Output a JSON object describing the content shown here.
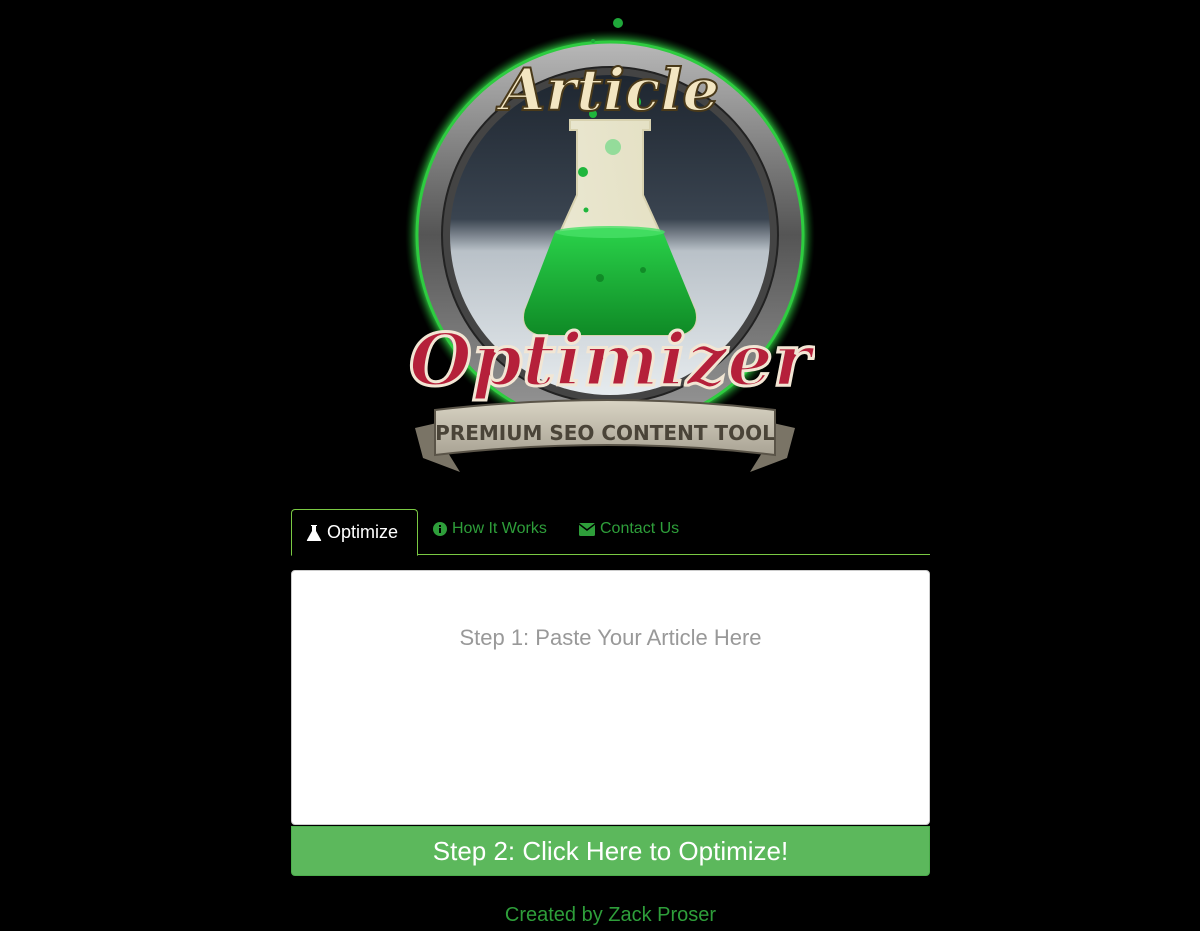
{
  "logo": {
    "word_top": "Article",
    "word_main": "Optimizer",
    "ribbon": "PREMIUM SEO CONTENT TOOL",
    "icon": "flask-logo"
  },
  "tabs": [
    {
      "label": "Optimize",
      "icon": "flask-icon",
      "active": true
    },
    {
      "label": "How It Works",
      "icon": "info-circle-icon",
      "active": false
    },
    {
      "label": "Contact Us",
      "icon": "envelope-icon",
      "active": false
    }
  ],
  "editor": {
    "placeholder": "Step 1: Paste Your Article Here",
    "value": ""
  },
  "optimize_button": {
    "label": "Step 2: Click Here to Optimize!"
  },
  "footer": {
    "credit": "Created by Zack Proser"
  },
  "colors": {
    "background": "#000000",
    "accent_green": "#2e9e3a",
    "tab_border": "#7ac943",
    "button_green": "#5cb85c",
    "logo_red": "#b5203a",
    "liquid_green": "#1fb63c"
  }
}
